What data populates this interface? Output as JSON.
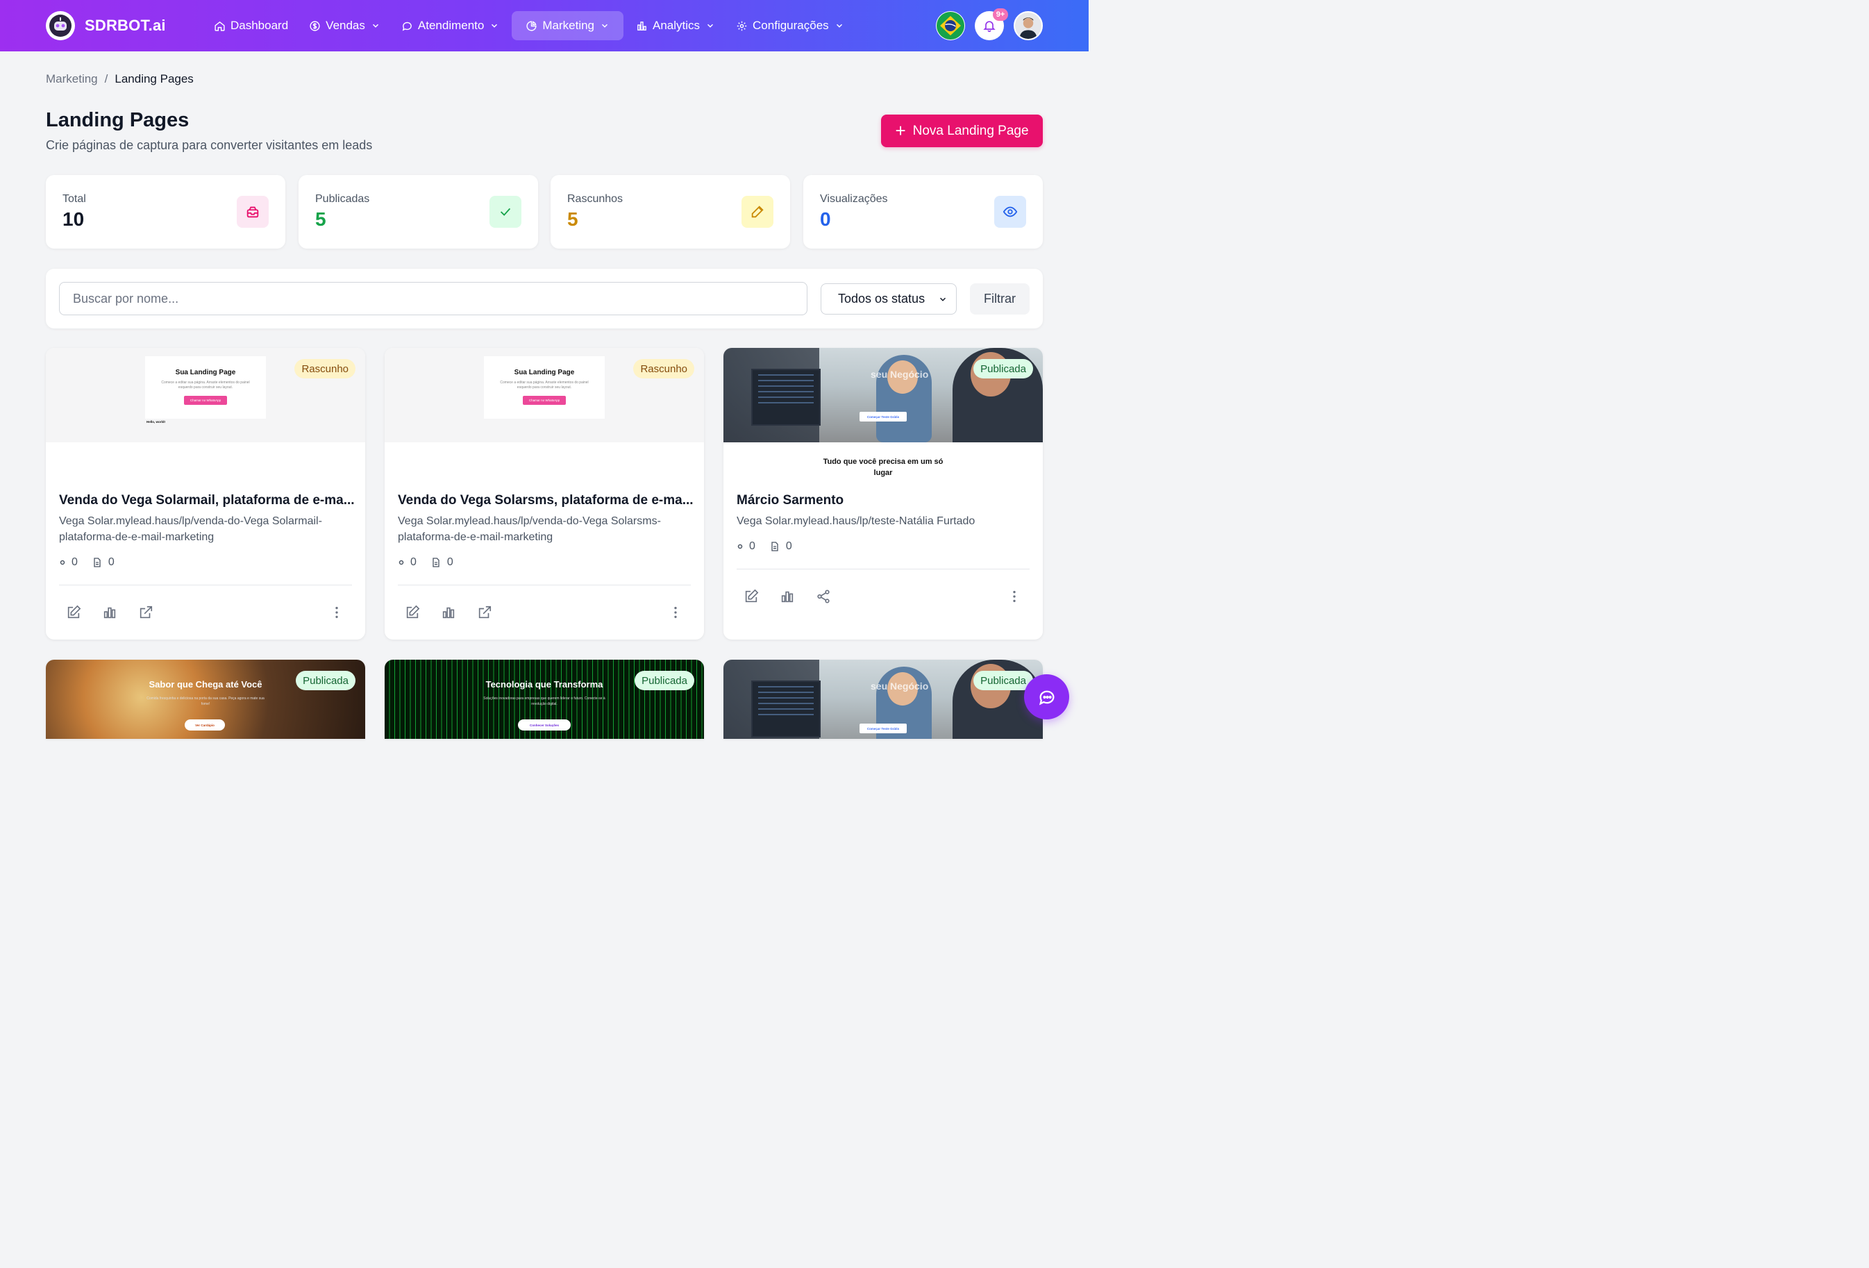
{
  "app": {
    "name": "SDRBOT.ai"
  },
  "nav": {
    "items": [
      {
        "label": "Dashboard",
        "icon": "home-icon",
        "dropdown": false
      },
      {
        "label": "Vendas",
        "icon": "dollar-circle-icon",
        "dropdown": true
      },
      {
        "label": "Atendimento",
        "icon": "chat-bubble-icon",
        "dropdown": true
      },
      {
        "label": "Marketing",
        "icon": "pie-chart-icon",
        "dropdown": true,
        "active": true
      },
      {
        "label": "Analytics",
        "icon": "bar-chart-icon",
        "dropdown": true
      },
      {
        "label": "Configurações",
        "icon": "gear-icon",
        "dropdown": true
      }
    ],
    "notifications_badge": "9+"
  },
  "breadcrumb": {
    "parent": "Marketing",
    "separator": "/",
    "current": "Landing Pages"
  },
  "header": {
    "title": "Landing Pages",
    "subtitle": "Crie páginas de captura para converter visitantes em leads",
    "new_button": "Nova Landing Page"
  },
  "stats": [
    {
      "label": "Total",
      "value": "10",
      "color": "#111827",
      "icon": "inbox-icon",
      "icon_bg": "#fce7f3",
      "icon_color": "#e8116d"
    },
    {
      "label": "Publicadas",
      "value": "5",
      "color": "#16a34a",
      "icon": "check-icon",
      "icon_bg": "#dcfce7",
      "icon_color": "#16a34a"
    },
    {
      "label": "Rascunhos",
      "value": "5",
      "color": "#ca8a04",
      "icon": "edit-icon",
      "icon_bg": "#fef9c3",
      "icon_color": "#ca8a04"
    },
    {
      "label": "Visualizações",
      "value": "0",
      "color": "#2563eb",
      "icon": "eye-icon",
      "icon_bg": "#dbeafe",
      "icon_color": "#2563eb"
    }
  ],
  "filters": {
    "search_placeholder": "Buscar por nome...",
    "status_value": "Todos os status",
    "filter_button": "Filtrar"
  },
  "cards": [
    {
      "status": "Rascunho",
      "preview": {
        "title": "Sua Landing Page",
        "text": "Comece a editar sua página. Arraste elementos do painel esquerdo para construir seu layout.",
        "button": "Chamar no WhatsApp",
        "hello": "Hello, world!"
      },
      "title": "Venda do Vega Solarmail, plataforma de e-ma...",
      "url": "Vega Solar.mylead.haus/lp/venda-do-Vega Solarmail-plataforma-de-e-mail-marketing",
      "views": "0",
      "leads": "0"
    },
    {
      "status": "Rascunho",
      "preview": {
        "title": "Sua Landing Page",
        "text": "Comece a editar sua página. Arraste elementos do painel esquerdo para construir seu layout.",
        "button": "Chamar no WhatsApp"
      },
      "title": "Venda do Vega Solarsms, plataforma de e-ma...",
      "url": "Vega Solar.mylead.haus/lp/venda-do-Vega Solarsms-plataforma-de-e-mail-marketing",
      "views": "0",
      "leads": "0"
    },
    {
      "status": "Publicada",
      "preview": {
        "headline": "seu Negócio",
        "button": "Começar Teste Grátis"
      },
      "tagline": "Tudo que você precisa em um só lugar",
      "title": "Márcio Sarmento",
      "url": "Vega Solar.mylead.haus/lp/teste-Natália Furtado",
      "views": "0",
      "leads": "0"
    },
    {
      "status": "Publicada",
      "preview": {
        "title": "Sabor que Chega até Você",
        "text": "Comida fresquinha e deliciosa na porta da sua casa. Peça agora e mate sua fome!",
        "button": "Ver Cardápio"
      }
    },
    {
      "status": "Publicada",
      "preview": {
        "title": "Tecnologia que Transforma",
        "text": "Soluções inovadoras para empresas que querem liderar o futuro. Conecte-se à revolução digital.",
        "button": "Conhecer Soluções"
      }
    },
    {
      "status": "Publicada",
      "preview": {
        "headline": "seu Negócio",
        "button": "Começar Teste Grátis"
      }
    }
  ]
}
